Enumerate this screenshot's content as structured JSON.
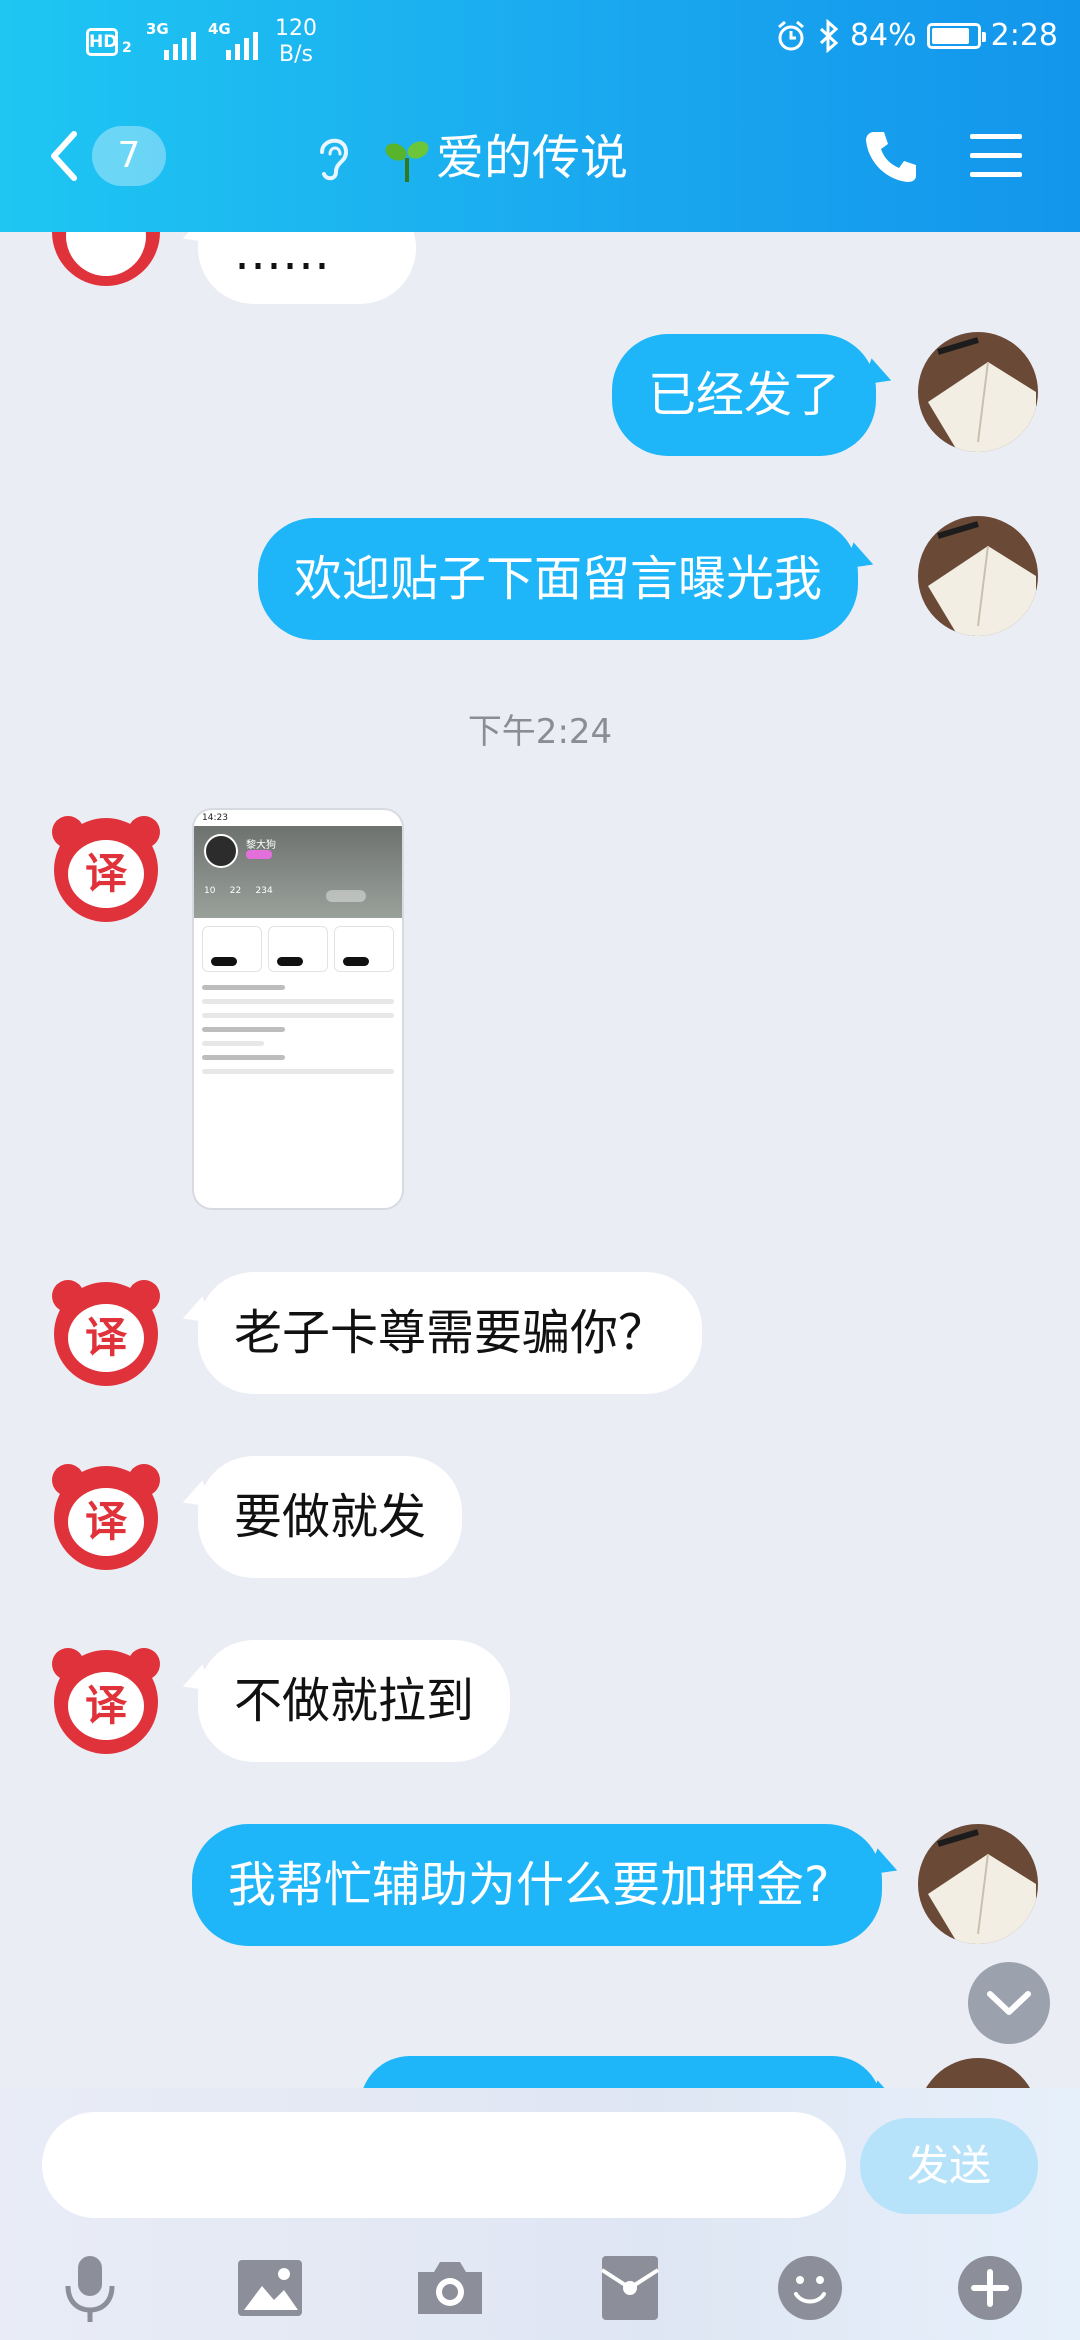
{
  "status_bar": {
    "hd": "HD",
    "hd_index": "2",
    "net1": "3G",
    "net2": "4G",
    "speed_value": "120",
    "speed_unit": "B/s",
    "battery": "84%",
    "battery_level": 0.84,
    "time": "2:28",
    "icons": [
      "alarm-icon",
      "bluetooth-icon",
      "battery-icon"
    ]
  },
  "header": {
    "unread_count": "7",
    "title": "爱的传说",
    "icons": [
      "back-icon",
      "ear-icon",
      "sprout-icon",
      "phone-icon",
      "menu-icon"
    ]
  },
  "messages": {
    "m_top_partial": "……",
    "m1": "已经发了",
    "m2": "欢迎贴子下面留言曝光我",
    "timestamp": "下午2:24",
    "m3": "老子卡尊需要骗你？",
    "m4": "要做就发",
    "m5": "不做就拉到",
    "m6": "我帮忙辅助为什么要加押金?"
  },
  "avatar_glyph": "译",
  "screenshot_card": {
    "status_time": "14:23",
    "name": "黎大狗",
    "stats": [
      "10",
      "22",
      "234"
    ]
  },
  "input_bar": {
    "placeholder": "",
    "send_label": "发送",
    "tools": [
      "microphone-icon",
      "image-icon",
      "camera-icon",
      "red-packet-icon",
      "emoji-icon",
      "plus-icon"
    ]
  },
  "colors": {
    "header_start": "#1ec6f2",
    "header_end": "#1296ec",
    "bubble_out": "#1eb6f8",
    "bubble_in": "#ffffff",
    "avatar_red": "#e0323a",
    "background": "#ebedf5",
    "send_disabled": "#b6e2fa"
  }
}
